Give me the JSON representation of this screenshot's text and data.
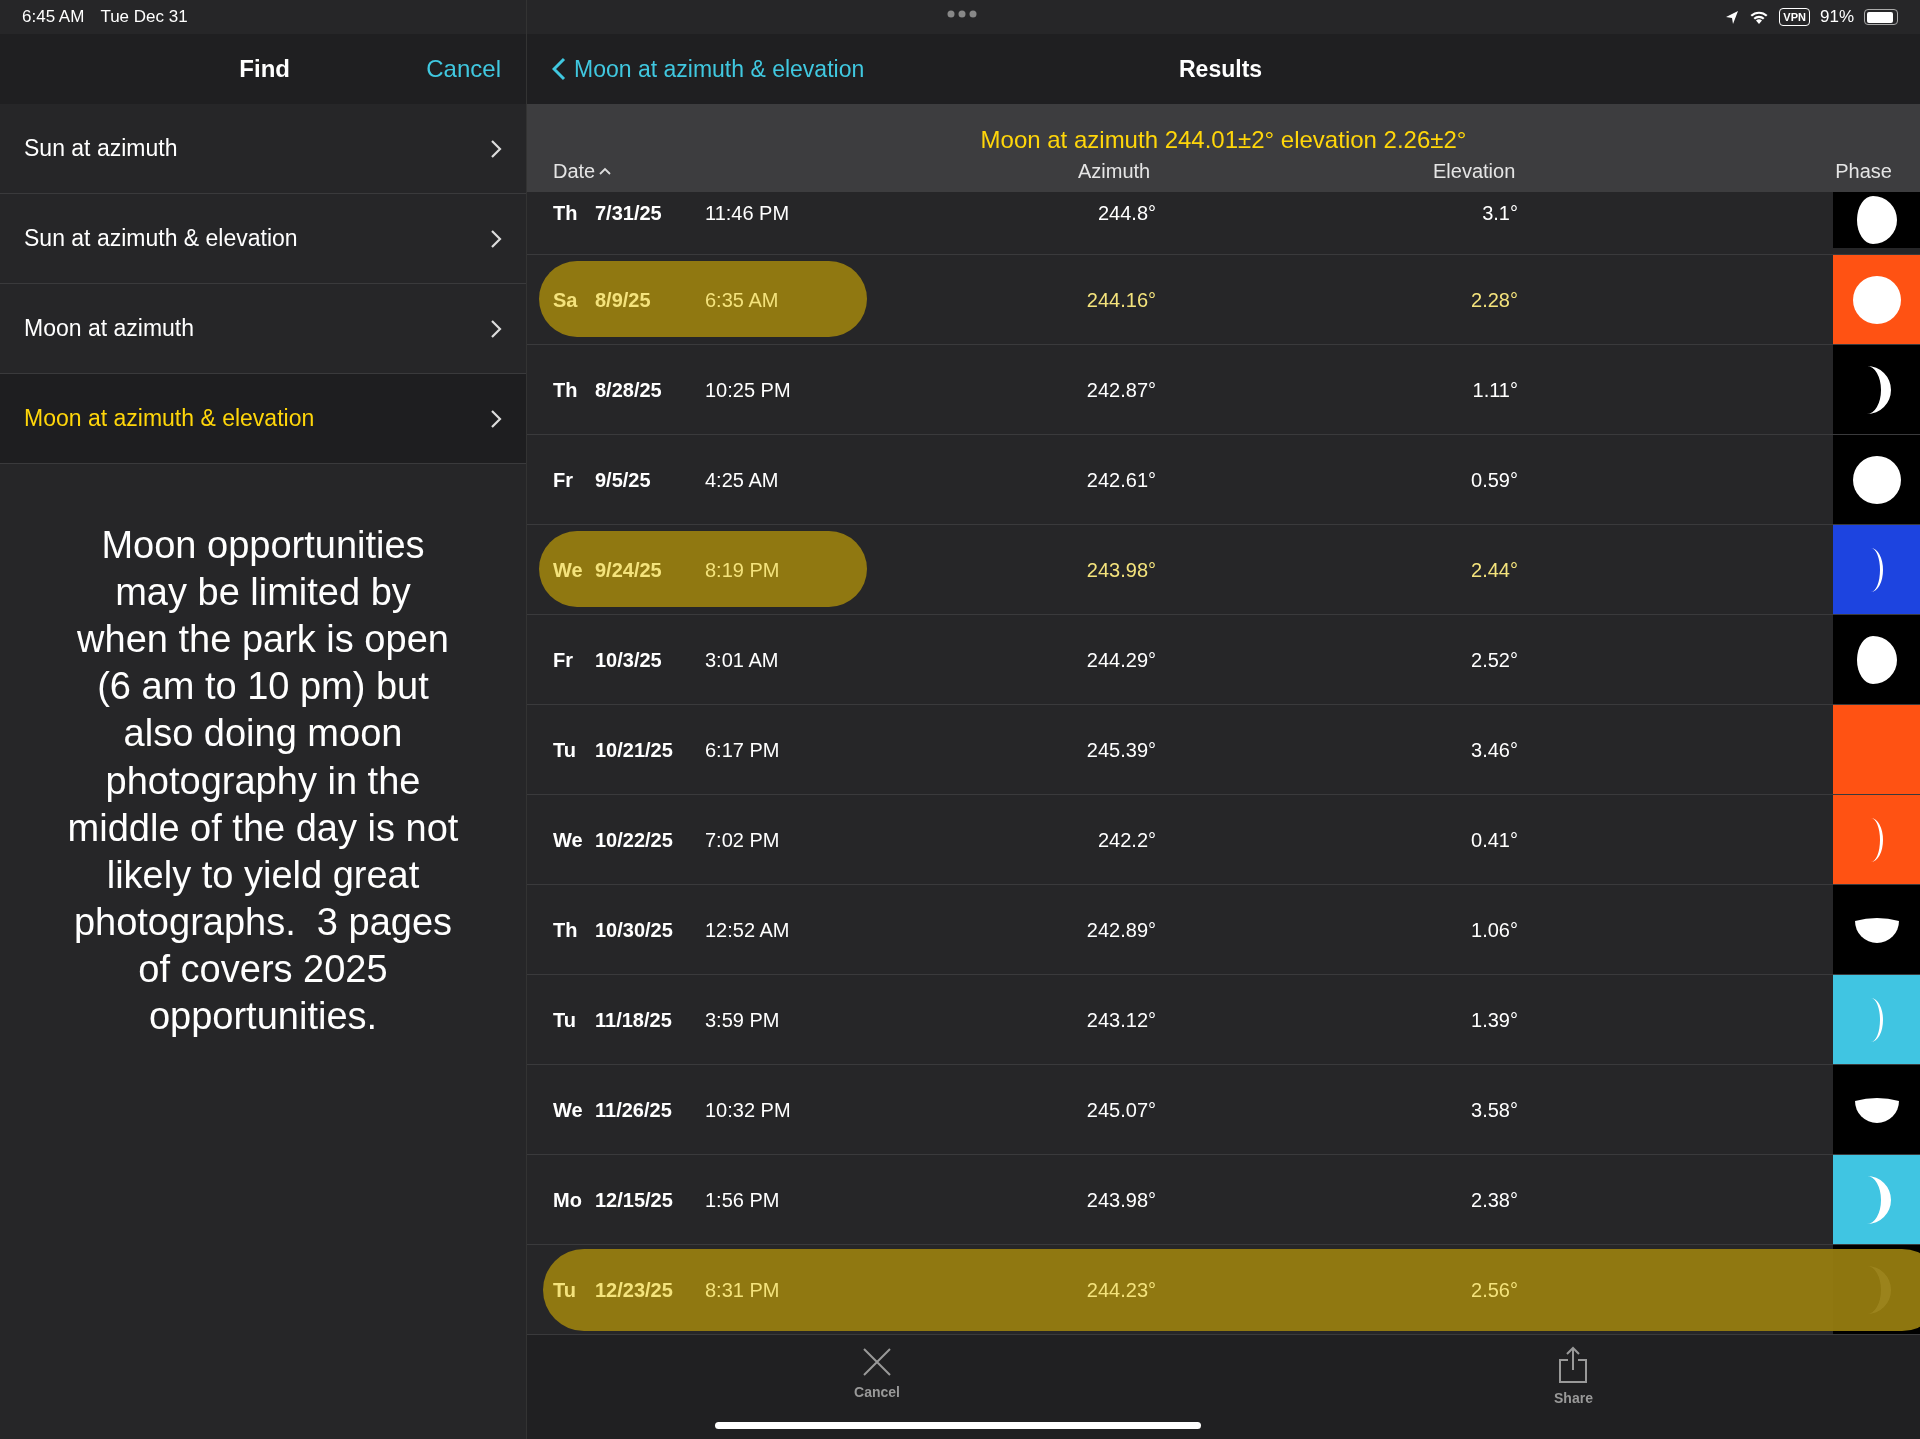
{
  "status_bar": {
    "time": "6:45 AM",
    "date": "Tue Dec 31",
    "vpn": "VPN",
    "battery": "91%"
  },
  "sidebar": {
    "title": "Find",
    "cancel": "Cancel",
    "items": [
      {
        "label": "Sun at azimuth",
        "selected": false
      },
      {
        "label": "Sun at azimuth & elevation",
        "selected": false
      },
      {
        "label": "Moon at azimuth",
        "selected": false
      },
      {
        "label": "Moon at azimuth & elevation",
        "selected": true
      }
    ],
    "note": "Moon opportunities may be limited by when the park is open (6 am to 10 pm) but also doing moon photography in the middle of the day is not likely to yield great photographs.  3 pages of covers 2025 opportunities."
  },
  "results": {
    "back": "Moon at azimuth & elevation",
    "title": "Results",
    "query": "Moon at azimuth 244.01±2° elevation 2.26±2°",
    "columns": [
      "Date",
      "Azimuth",
      "Elevation",
      "Phase"
    ],
    "rows": [
      {
        "kind": "plain",
        "day": "Th",
        "date": "7/31/25",
        "time": "11:46 PM",
        "azimuth": "244.8°",
        "elevation": "3.1°",
        "phase": {
          "kind": "gibbous",
          "color": "#000000"
        }
      },
      {
        "kind": "marked",
        "day": "Sa",
        "date": "8/9/25",
        "time": "6:35 AM",
        "azimuth": "244.16°",
        "elevation": "2.28°",
        "phase": {
          "kind": "full",
          "color": "#ff5213"
        }
      },
      {
        "kind": "plain",
        "day": "Th",
        "date": "8/28/25",
        "time": "10:25 PM",
        "azimuth": "242.87°",
        "elevation": "1.11°",
        "phase": {
          "kind": "crescent",
          "color": "#000000"
        }
      },
      {
        "kind": "plain",
        "day": "Fr",
        "date": "9/5/25",
        "time": "4:25 AM",
        "azimuth": "242.61°",
        "elevation": "0.59°",
        "phase": {
          "kind": "full",
          "color": "#000000"
        }
      },
      {
        "kind": "marked",
        "day": "We",
        "date": "9/24/25",
        "time": "8:19 PM",
        "azimuth": "243.98°",
        "elevation": "2.44°",
        "phase": {
          "kind": "thin",
          "color": "#1d44e0"
        }
      },
      {
        "kind": "plain",
        "day": "Fr",
        "date": "10/3/25",
        "time": "3:01 AM",
        "azimuth": "244.29°",
        "elevation": "2.52°",
        "phase": {
          "kind": "gibbous",
          "color": "#000000"
        }
      },
      {
        "kind": "plain",
        "day": "Tu",
        "date": "10/21/25",
        "time": "6:17 PM",
        "azimuth": "245.39°",
        "elevation": "3.46°",
        "phase": {
          "kind": "new",
          "color": "#ff5213"
        }
      },
      {
        "kind": "plain",
        "day": "We",
        "date": "10/22/25",
        "time": "7:02 PM",
        "azimuth": "242.2°",
        "elevation": "0.41°",
        "phase": {
          "kind": "thin",
          "color": "#ff5213"
        }
      },
      {
        "kind": "plain",
        "day": "Th",
        "date": "10/30/25",
        "time": "12:52 AM",
        "azimuth": "242.89°",
        "elevation": "1.06°",
        "phase": {
          "kind": "half",
          "color": "#000000"
        }
      },
      {
        "kind": "plain",
        "day": "Tu",
        "date": "11/18/25",
        "time": "3:59 PM",
        "azimuth": "243.12°",
        "elevation": "1.39°",
        "phase": {
          "kind": "thin",
          "color": "#40c5e2"
        }
      },
      {
        "kind": "plain",
        "day": "We",
        "date": "11/26/25",
        "time": "10:32 PM",
        "azimuth": "245.07°",
        "elevation": "3.58°",
        "phase": {
          "kind": "half",
          "color": "#000000"
        }
      },
      {
        "kind": "plain",
        "day": "Mo",
        "date": "12/15/25",
        "time": "1:56 PM",
        "azimuth": "243.98°",
        "elevation": "2.38°",
        "phase": {
          "kind": "crescent",
          "color": "#40c5e2"
        }
      },
      {
        "kind": "marked_wide",
        "day": "Tu",
        "date": "12/23/25",
        "time": "8:31 PM",
        "azimuth": "244.23°",
        "elevation": "2.56°",
        "phase": {
          "kind": "crescent",
          "color": "#000000"
        }
      }
    ]
  },
  "toolbar": [
    {
      "label": "Cancel",
      "kind": "cancel"
    },
    {
      "label": "Share",
      "kind": "share"
    }
  ]
}
